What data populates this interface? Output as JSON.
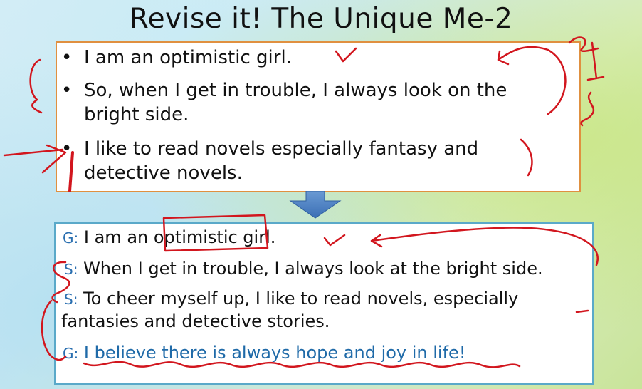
{
  "slide": {
    "title": "Revise it! The Unique Me-2"
  },
  "original_box": {
    "bullet_symbol": "•",
    "items": [
      {
        "lines": [
          "I am an optimistic girl."
        ]
      },
      {
        "lines": [
          "So, when I get in trouble, I always look on the",
          "bright side."
        ]
      },
      {
        "lines": [
          "I like to read novels especially fantasy and",
          "detective novels."
        ]
      }
    ]
  },
  "revised_box": {
    "lines": [
      {
        "tag": "G:",
        "text": "I am an optimistic girl."
      },
      {
        "tag": "S:",
        "text": "When I get in trouble, I always look at the bright side."
      },
      {
        "tag": "S:",
        "text": "To cheer myself up, I like to read novels, especially"
      },
      {
        "tag": "",
        "text": "fantasies and detective stories."
      },
      {
        "tag": "G:",
        "text": "I believe there is always hope and joy in life!"
      }
    ]
  },
  "colors": {
    "original_border": "#e09040",
    "revised_border": "#5aa9c9",
    "arrow": "#4a7fc0",
    "tag_text": "#2a6fb0",
    "conclusion_text": "#1f6aa8",
    "annotation_ink": "#d2161e"
  }
}
